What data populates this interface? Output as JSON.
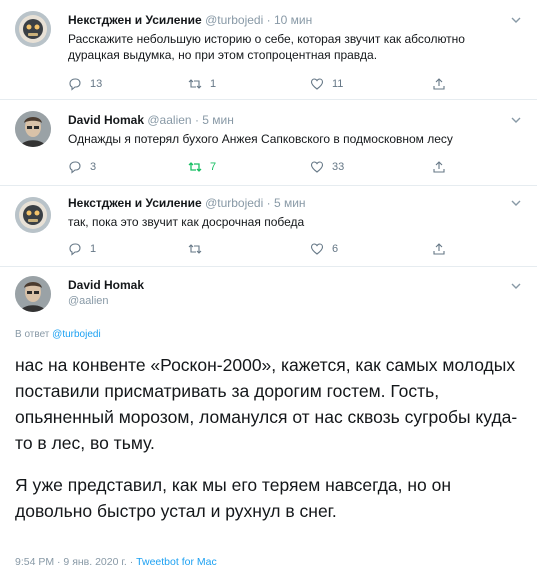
{
  "tweets": [
    {
      "name": "Некстджен и Усиление",
      "handle": "@turbojedi",
      "time": "· 10 мин",
      "text": "Расскажите небольшую историю о себе, которая звучит как абсолютно дурацкая выдумка, но при этом стопроцентная правда.",
      "replies": "13",
      "retweets": "1",
      "likes": "11",
      "avatar": "robot-avatar"
    },
    {
      "name": "David Homak",
      "handle": "@aalien",
      "time": "· 5 мин",
      "text": "Однажды я потерял бухого Анжея Сапковского в подмосковном лесу",
      "replies": "3",
      "retweets": "7",
      "likes": "33",
      "retweeted": true,
      "avatar": "man-avatar"
    },
    {
      "name": "Некстджен и Усиление",
      "handle": "@turbojedi",
      "time": "· 5 мин",
      "text": "так, пока это звучит как досрочная победа",
      "replies": "1",
      "retweets": "",
      "likes": "6",
      "avatar": "robot-avatar"
    }
  ],
  "main": {
    "name": "David Homak",
    "handle": "@aalien",
    "reply_prefix": "В ответ ",
    "reply_to": "@turbojedi",
    "paragraphs": [
      "нас на конвенте «Роскон-2000», кажется, как самых молодых поставили присматривать за дорогим гостем. Гость, опьяненный морозом, ломанулся от нас сквозь сугробы куда-то в лес, во тьму.",
      "Я уже представил, как мы его теряем навсегда, но он довольно быстро устал и рухнул в снег."
    ],
    "timestamp": "9:54 PM · 9 янв. 2020 г. · ",
    "client": "Tweetbot for Mac"
  },
  "colors": {
    "accent": "#1da1f2",
    "retweet_green": "#17bf63",
    "muted": "#8899a6",
    "divider": "#e6ecf0"
  }
}
